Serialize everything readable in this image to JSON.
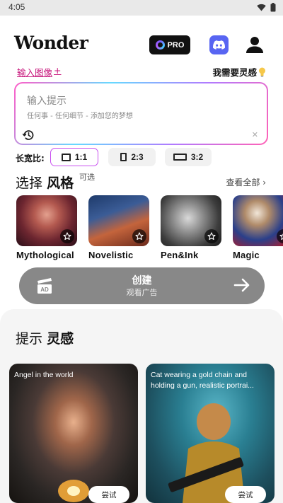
{
  "status": {
    "time": "4:05"
  },
  "header": {
    "logo": "Wonder",
    "pro_label": "PRO"
  },
  "links": {
    "upload": "输入图像",
    "upload_plus": "+",
    "inspire": "我需要灵感"
  },
  "prompt": {
    "title": "输入提示",
    "subtitle": "任何事 - 任何细节 - 添加您的梦想"
  },
  "ratio": {
    "label": "长宽比:",
    "options": [
      {
        "label": "1:1",
        "selected": true
      },
      {
        "label": "2:3",
        "selected": false
      },
      {
        "label": "3:2",
        "selected": false
      }
    ]
  },
  "styles": {
    "title_a": "选择",
    "title_b": "风格",
    "optional": "可选",
    "see_all": "查看全部",
    "items": [
      {
        "name": "Mythological"
      },
      {
        "name": "Novelistic"
      },
      {
        "name": "Pen&Ink"
      },
      {
        "name": "Magic"
      }
    ]
  },
  "create": {
    "label": "创建",
    "sublabel": "观看广告",
    "ad_badge": "AD"
  },
  "inspiration": {
    "title_a": "提示",
    "title_b": "灵感",
    "cards": [
      {
        "prompt": "Angel in the world",
        "try_label": "尝试"
      },
      {
        "prompt": "Cat wearing a gold chain and holding a gun, realistic portrai...",
        "try_label": "尝试"
      }
    ]
  },
  "colors": {
    "accent_pink": "#c8187d",
    "discord": "#5865f2",
    "create_button": "#888888"
  }
}
